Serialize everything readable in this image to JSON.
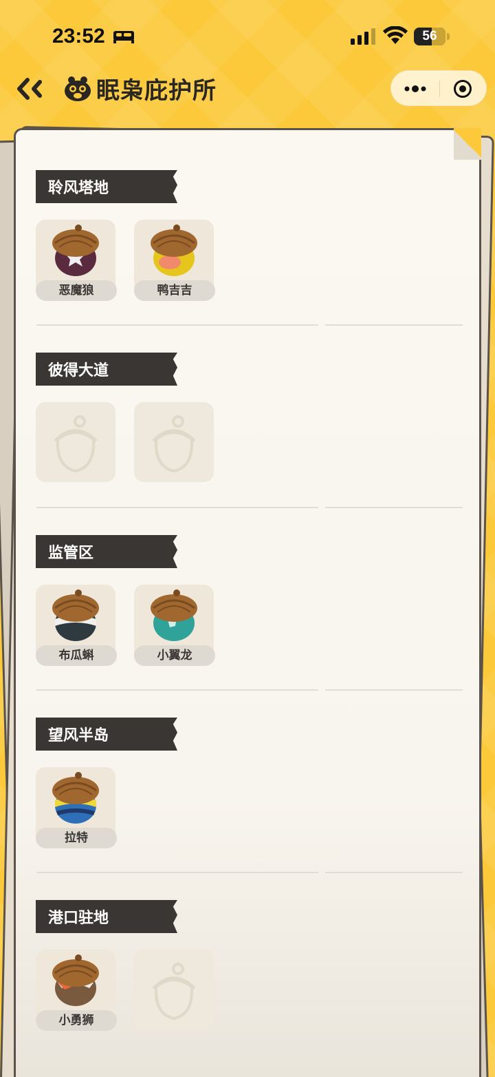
{
  "status_bar": {
    "time": "23:52",
    "battery_level": "56"
  },
  "header": {
    "title": "眠枭庇护所"
  },
  "sections": [
    {
      "title": "聆风塔地",
      "slots": [
        {
          "state": "filled",
          "name": "恶魔狼",
          "color": "#5A2A3E",
          "icon": "acorn-star"
        },
        {
          "state": "filled",
          "name": "鸭吉吉",
          "color": "#E6C51C",
          "icon": "acorn-duck"
        }
      ]
    },
    {
      "title": "彼得大道",
      "slots": [
        {
          "state": "empty",
          "name": "",
          "icon": "acorn-placeholder"
        },
        {
          "state": "empty",
          "name": "",
          "icon": "acorn-placeholder"
        }
      ]
    },
    {
      "title": "监管区",
      "slots": [
        {
          "state": "filled",
          "name": "布瓜蝌",
          "color": "#2F3A40",
          "icon": "acorn-stripe"
        },
        {
          "state": "filled",
          "name": "小翼龙",
          "color": "#2FA39A",
          "icon": "acorn-wing"
        }
      ]
    },
    {
      "title": "望风半岛",
      "slots": [
        {
          "state": "filled",
          "name": "拉特",
          "color": "#2E6FB8",
          "icon": "acorn-stripe-yellow"
        }
      ]
    },
    {
      "title": "港口驻地",
      "slots": [
        {
          "state": "filled",
          "name": "小勇狮",
          "color": "#7A5A3E",
          "icon": "acorn-lion"
        },
        {
          "state": "empty",
          "name": "",
          "icon": "acorn-placeholder"
        }
      ]
    }
  ],
  "colors": {
    "background": "#FBC93A",
    "banner": "#3A3633",
    "paper": "#FAF8F1"
  }
}
